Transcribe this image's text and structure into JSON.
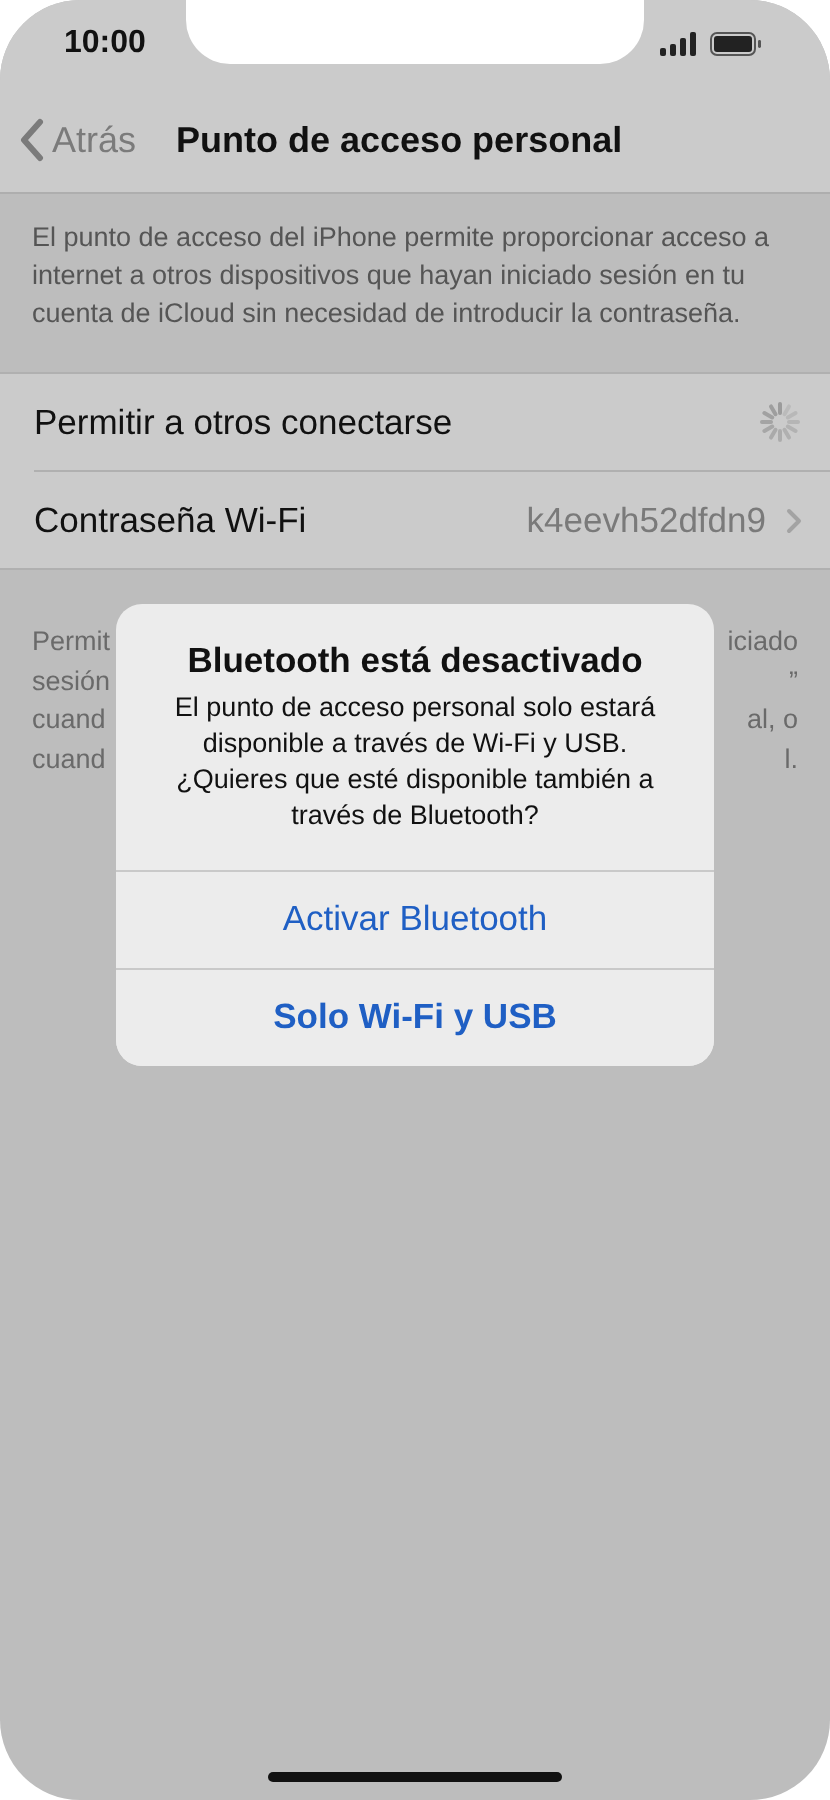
{
  "status_bar": {
    "time": "10:00"
  },
  "nav": {
    "back": "Atrás",
    "title": "Punto de acceso personal"
  },
  "description": "El punto de acceso del iPhone permite proporcionar acceso a internet a otros dispositivos que hayan iniciado sesión en tu cuenta de iCloud sin necesidad de introducir la contraseña.",
  "settings": [
    {
      "kind": "spinner",
      "label": "Permitir a otros conectarse"
    },
    {
      "kind": "disclosure",
      "label": "Contraseña Wi-Fi",
      "value": "k4eevh52dfdn9"
    }
  ],
  "footer_lines": [
    {
      "left": "Permit",
      "right": "iciado"
    },
    {
      "left": "sesión",
      "right": "”"
    },
    {
      "left": "cuand",
      "right": "al, o"
    },
    {
      "left": "cuand",
      "right": "l."
    }
  ],
  "alert": {
    "title": "Bluetooth está desactivado",
    "message": "El punto de acceso personal solo estará disponible a través de Wi-Fi y USB. ¿Quieres que esté disponible también a través de Bluetooth?",
    "buttons": [
      {
        "label": "Activar Bluetooth",
        "bold": false
      },
      {
        "label": "Solo Wi-Fi y USB",
        "bold": true
      }
    ]
  }
}
